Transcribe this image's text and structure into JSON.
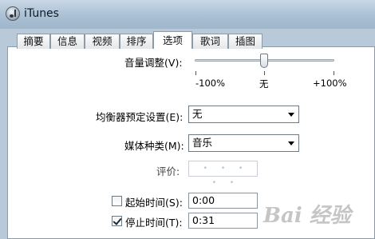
{
  "window": {
    "title": "iTunes"
  },
  "tabs": [
    {
      "label": "摘要",
      "active": false
    },
    {
      "label": "信息",
      "active": false
    },
    {
      "label": "视频",
      "active": false
    },
    {
      "label": "排序",
      "active": false
    },
    {
      "label": "选项",
      "active": true
    },
    {
      "label": "歌词",
      "active": false
    },
    {
      "label": "插图",
      "active": false
    }
  ],
  "options": {
    "volume": {
      "label": "音量调整",
      "shortcut": "(V):",
      "tick_min": "-100%",
      "tick_mid": "无",
      "tick_max": "+100%",
      "value_percent": 0
    },
    "equalizer": {
      "label": "均衡器预定设置",
      "shortcut": "(E):",
      "selected": "无"
    },
    "media_kind": {
      "label": "媒体种类",
      "shortcut": "(M):",
      "selected": "音乐"
    },
    "rating": {
      "label": "评价:",
      "stars": "• • • • •"
    },
    "start_time": {
      "label": "起始时间",
      "shortcut": "(S):",
      "checked": false,
      "value": "0:00"
    },
    "stop_time": {
      "label": "停止时间",
      "shortcut": "(T):",
      "checked": true,
      "value": "0:31"
    }
  },
  "watermark": {
    "text": "Bai 经验"
  },
  "colors": {
    "titlebar": "#aac0d4",
    "panel_border": "#8e9ba7"
  }
}
